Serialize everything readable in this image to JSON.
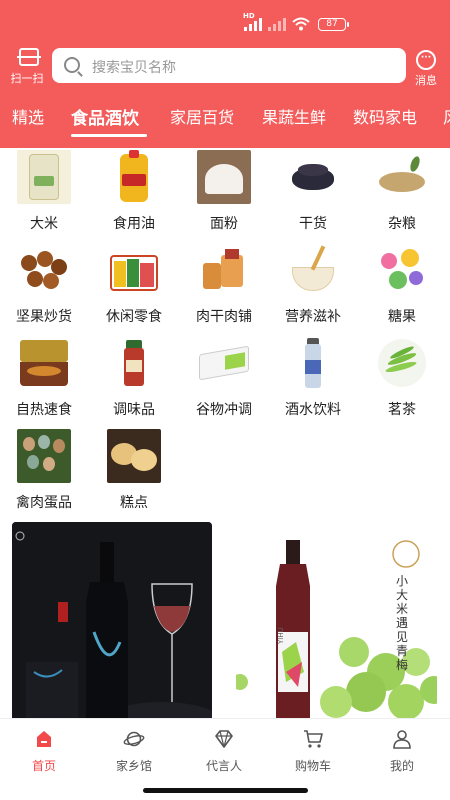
{
  "status_bar": {
    "network": "HD",
    "battery": "87"
  },
  "header": {
    "scan_label": "扫一扫",
    "search_placeholder": "搜索宝贝名称",
    "message_label": "消息"
  },
  "tabs": [
    {
      "label": "精选",
      "active": false
    },
    {
      "label": "食品酒饮",
      "active": true
    },
    {
      "label": "家居百货",
      "active": false
    },
    {
      "label": "果蔬生鲜",
      "active": false
    },
    {
      "label": "数码家电",
      "active": false
    },
    {
      "label": "风",
      "active": false
    }
  ],
  "categories": [
    {
      "label": "大米",
      "icon": "rice-bag-icon"
    },
    {
      "label": "食用油",
      "icon": "oil-bottle-icon"
    },
    {
      "label": "面粉",
      "icon": "flour-icon"
    },
    {
      "label": "干货",
      "icon": "dried-goods-icon"
    },
    {
      "label": "杂粮",
      "icon": "grains-icon"
    },
    {
      "label": "坚果炒货",
      "icon": "nuts-icon"
    },
    {
      "label": "休闲零食",
      "icon": "snacks-icon"
    },
    {
      "label": "肉干肉铺",
      "icon": "jerky-icon"
    },
    {
      "label": "营养滋补",
      "icon": "nutrition-icon"
    },
    {
      "label": "糖果",
      "icon": "candy-icon"
    },
    {
      "label": "自热速食",
      "icon": "instant-food-icon"
    },
    {
      "label": "调味品",
      "icon": "seasoning-icon"
    },
    {
      "label": "谷物冲调",
      "icon": "cereal-icon"
    },
    {
      "label": "酒水饮料",
      "icon": "beverage-icon"
    },
    {
      "label": "茗茶",
      "icon": "tea-icon"
    },
    {
      "label": "禽肉蛋品",
      "icon": "eggs-icon"
    },
    {
      "label": "糕点",
      "icon": "pastry-icon"
    }
  ],
  "banners": {
    "right_text": "小大米遇见青梅",
    "bottle_label": "YIHU"
  },
  "tabbar": [
    {
      "label": "首页",
      "icon": "home-icon",
      "active": true
    },
    {
      "label": "家乡馆",
      "icon": "planet-icon",
      "active": false
    },
    {
      "label": "代言人",
      "icon": "diamond-icon",
      "active": false
    },
    {
      "label": "购物车",
      "icon": "cart-icon",
      "active": false
    },
    {
      "label": "我的",
      "icon": "user-icon",
      "active": false
    }
  ],
  "colors": {
    "brand": "#f45c5c",
    "active_tab": "#f24a4a"
  }
}
